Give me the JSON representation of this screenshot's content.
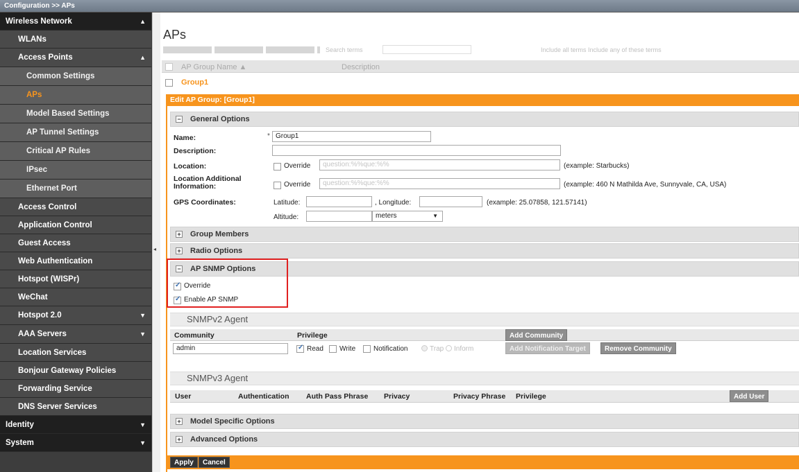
{
  "breadcrumb": "Configuration >> APs",
  "sidebar": [
    {
      "label": "Wireless Network",
      "chevron": "▲"
    },
    {
      "label": "WLANs",
      "chevron": ""
    },
    {
      "label": "Access Points",
      "chevron": "▲"
    },
    {
      "label": "Common Settings",
      "chevron": ""
    },
    {
      "label": "APs",
      "chevron": ""
    },
    {
      "label": "Model Based Settings",
      "chevron": ""
    },
    {
      "label": "AP Tunnel Settings",
      "chevron": ""
    },
    {
      "label": "Critical AP Rules",
      "chevron": ""
    },
    {
      "label": "IPsec",
      "chevron": ""
    },
    {
      "label": "Ethernet Port",
      "chevron": ""
    },
    {
      "label": "Access Control",
      "chevron": ""
    },
    {
      "label": "Application Control",
      "chevron": ""
    },
    {
      "label": "Guest Access",
      "chevron": ""
    },
    {
      "label": "Web Authentication",
      "chevron": ""
    },
    {
      "label": "Hotspot (WISPr)",
      "chevron": ""
    },
    {
      "label": "WeChat",
      "chevron": ""
    },
    {
      "label": "Hotspot 2.0",
      "chevron": "▼"
    },
    {
      "label": "AAA Servers",
      "chevron": "▼"
    },
    {
      "label": "Location Services",
      "chevron": ""
    },
    {
      "label": "Bonjour Gateway Policies",
      "chevron": ""
    },
    {
      "label": "Forwarding Service",
      "chevron": ""
    },
    {
      "label": "DNS Server Services",
      "chevron": ""
    },
    {
      "label": "Identity",
      "chevron": "▼"
    },
    {
      "label": "System",
      "chevron": "▼"
    }
  ],
  "main": {
    "title": "APs",
    "toolbar_blur": "Search terms",
    "toolbar_blur_right": "Include all terms   Include any of these terms",
    "table": {
      "col_name": "AP Group Name ▲",
      "col_desc": "Description",
      "row_name": "Group1"
    },
    "edit_header": "Edit AP Group: [Group1]",
    "general": {
      "section": "General Options",
      "name_label": "Name:",
      "required": "*",
      "name_value": "Group1",
      "desc_label": "Description:",
      "desc_value": "",
      "loc_label": "Location:",
      "override": "Override",
      "loc_placeholder": "question:%%que:%%",
      "loc_example": "(example: Starbucks)",
      "locadd_label": "Location Additional Information:",
      "locadd_placeholder": "question:%%que:%%",
      "locadd_example": "(example: 460 N Mathilda Ave, Sunnyvale, CA, USA)",
      "gps_label": "GPS Coordinates:",
      "lat_label": "Latitude:",
      "lon_label": ", Longitude:",
      "gps_example": "(example: 25.07858, 121.57141)",
      "alt_label": "Altitude:",
      "alt_unit": "meters"
    },
    "group_members": "Group Members",
    "radio_options": "Radio Options",
    "snmp": {
      "section": "AP SNMP Options",
      "override": "Override",
      "enable": "Enable AP SNMP",
      "override_checked": true,
      "enable_checked": true
    },
    "snmpv2": {
      "title": "SNMPv2 Agent",
      "col_community": "Community",
      "col_privilege": "Privilege",
      "add_community": "Add Community",
      "community_value": "admin",
      "read": "Read",
      "write": "Write",
      "notification": "Notification",
      "trap": "Trap",
      "inform": "Inform",
      "add_target": "Add Notification Target",
      "remove": "Remove Community"
    },
    "snmpv3": {
      "title": "SNMPv3 Agent",
      "cols": [
        "User",
        "Authentication",
        "Auth Pass Phrase",
        "Privacy",
        "Privacy Phrase",
        "Privilege"
      ],
      "add_user": "Add User"
    },
    "model_specific": "Model Specific Options",
    "advanced": "Advanced Options",
    "apply": "Apply",
    "cancel": "Cancel",
    "highlight_color": "#e02020",
    "accent_color": "#f7941d"
  }
}
